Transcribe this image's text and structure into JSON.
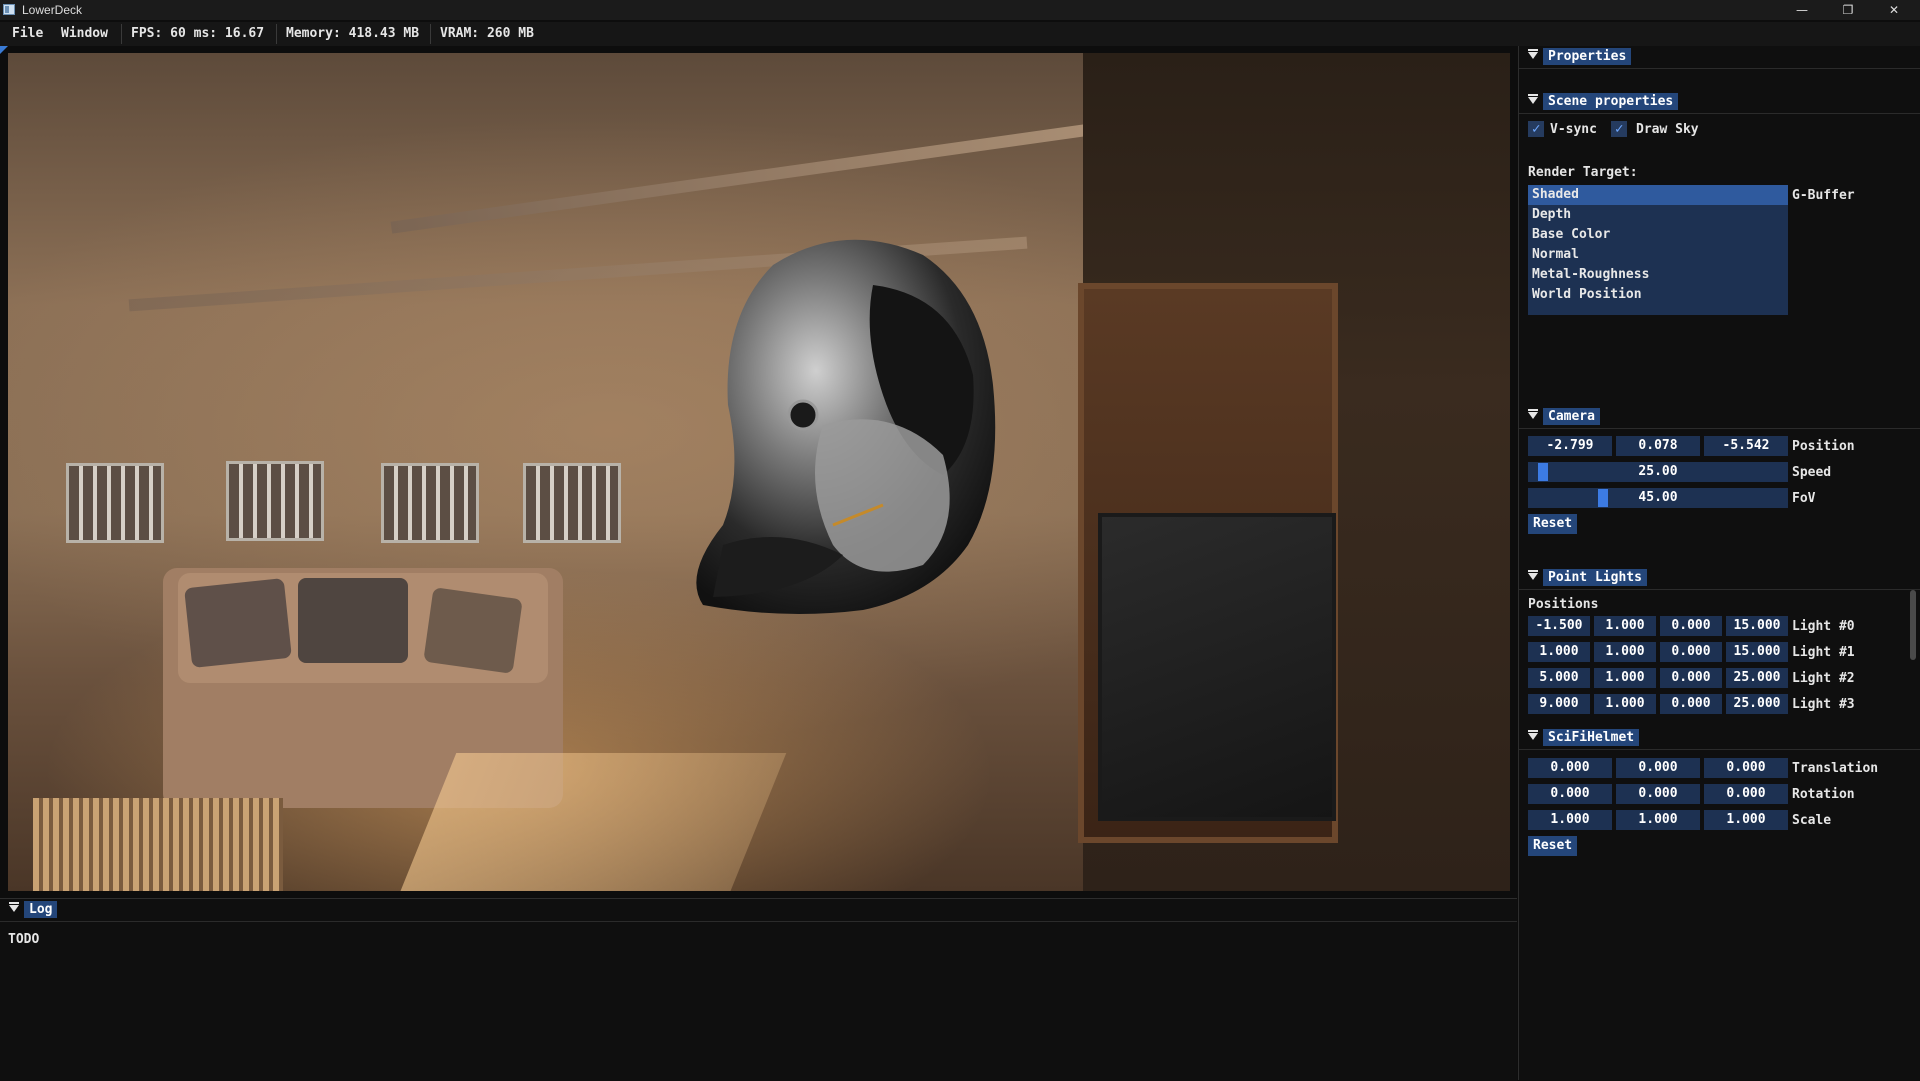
{
  "window": {
    "title": "LowerDeck",
    "icon": "app-window-icon",
    "controls": [
      "minimize-icon",
      "restore-icon",
      "close-icon"
    ]
  },
  "menubar": {
    "file": "File",
    "window": "Window",
    "fps": "FPS: 60 ms: 16.67",
    "memory": "Memory: 418.43 MB",
    "vram": "VRAM: 260 MB"
  },
  "properties": {
    "title": "Properties"
  },
  "scene": {
    "title": "Scene properties",
    "vsync_label": "V-sync",
    "vsync_checked": true,
    "drawsky_label": "Draw Sky",
    "drawsky_checked": true,
    "render_target_label": "Render Target:",
    "gbuffer_label": "G-Buffer",
    "render_targets": [
      "Shaded",
      "Depth",
      "Base Color",
      "Normal",
      "Metal-Roughness",
      "World Position"
    ],
    "selected_target": "Shaded"
  },
  "camera": {
    "title": "Camera",
    "position": [
      "-2.799",
      "0.078",
      "-5.542"
    ],
    "position_label": "Position",
    "speed": "25.00",
    "speed_label": "Speed",
    "fov": "45.00",
    "fov_label": "FoV",
    "reset": "Reset"
  },
  "point_lights": {
    "title": "Point Lights",
    "positions_label": "Positions",
    "lights": [
      {
        "values": [
          "-1.500",
          "1.000",
          "0.000",
          "15.000"
        ],
        "label": "Light #0"
      },
      {
        "values": [
          "1.000",
          "1.000",
          "0.000",
          "15.000"
        ],
        "label": "Light #1"
      },
      {
        "values": [
          "5.000",
          "1.000",
          "0.000",
          "25.000"
        ],
        "label": "Light #2"
      },
      {
        "values": [
          "9.000",
          "1.000",
          "0.000",
          "25.000"
        ],
        "label": "Light #3"
      }
    ]
  },
  "helmet": {
    "title": "SciFiHelmet",
    "translation": [
      "0.000",
      "0.000",
      "0.000"
    ],
    "translation_label": "Translation",
    "rotation": [
      "0.000",
      "0.000",
      "0.000"
    ],
    "rotation_label": "Rotation",
    "scale": [
      "1.000",
      "1.000",
      "1.000"
    ],
    "scale_label": "Scale",
    "reset": "Reset"
  },
  "log": {
    "title": "Log",
    "text": "TODO"
  },
  "colors": {
    "accent": "#24467a",
    "field_bg": "#1d3152",
    "selected": "#2f5a9e",
    "slider": "#3c7be3",
    "background": "#0f0f0f"
  }
}
